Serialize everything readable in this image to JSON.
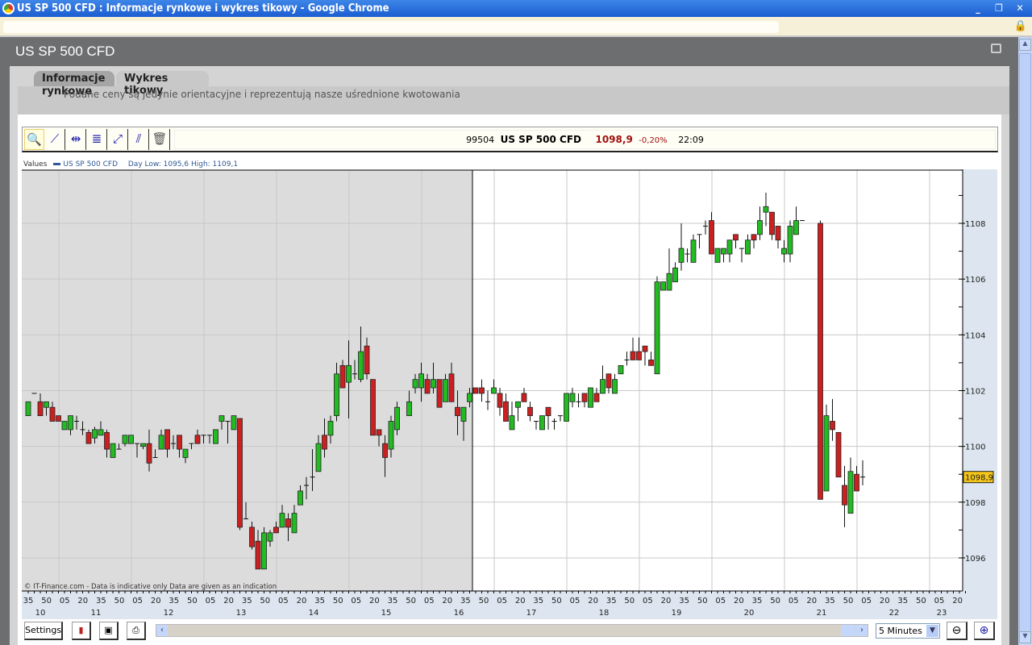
{
  "window": {
    "title": "US SP 500 CFD : Informacje rynkowe i wykres tikowy - Google Chrome",
    "buttons": [
      "_",
      "❐",
      "✕"
    ]
  },
  "page": {
    "title": "US SP 500 CFD"
  },
  "tabs": [
    {
      "label": "Informacje rynkowe"
    },
    {
      "label": "Wykres tikowy"
    }
  ],
  "disclaimer": "Podane ceny są jedynie orientacyjne i reprezentują nasze uśrednione kwotowania",
  "toolbar": {
    "tools": [
      {
        "icon": "zoom-icon",
        "glyph": "🔍"
      },
      {
        "icon": "trendline-icon",
        "glyph": "⟋"
      },
      {
        "icon": "horizontal-line-icon",
        "glyph": "⇹"
      },
      {
        "icon": "fibonacci-icon",
        "glyph": "≣"
      },
      {
        "icon": "channel-icon",
        "glyph": "⤢"
      },
      {
        "icon": "parallel-lines-icon",
        "glyph": "⫽"
      },
      {
        "icon": "trash-icon",
        "glyph": "🗑"
      }
    ]
  },
  "quote": {
    "code": "99504",
    "name": "US SP 500 CFD",
    "price": "1098,9",
    "change": "-0,20%",
    "time": "22:09"
  },
  "legend": {
    "label": "Values",
    "series": "US SP 500 CFD",
    "day_range": "Day Low: 1095,6 High: 1109,1"
  },
  "copyright": "© IT-Finance.com - Data is indicative only Data are given as an indication",
  "colors": {
    "up": "#22bb22",
    "down": "#cc2020",
    "shade": "#dcdcdc",
    "axis_bg": "#dde6f0",
    "price_tag": "#f5c518"
  },
  "chart_data": {
    "type": "candlestick",
    "interval": "5 Minutes",
    "ylim": [
      1095,
      1110
    ],
    "yticks": [
      1096,
      1098,
      1100,
      1102,
      1104,
      1106,
      1108
    ],
    "ytick_labels": [
      "1096",
      "1098",
      "1100",
      "1102",
      "1104",
      "1106",
      "1108"
    ],
    "last_price": 1098.9,
    "last_price_label": "1098,9",
    "xtick_labels": [
      "35",
      "50",
      "05",
      "20",
      "35",
      "50",
      "05",
      "20",
      "35",
      "50",
      "05",
      "20",
      "35",
      "50",
      "05",
      "20",
      "35",
      "50",
      "05",
      "20",
      "35",
      "50",
      "05",
      "20",
      "35",
      "50",
      "05",
      "20",
      "35",
      "50",
      "05",
      "20",
      "35",
      "50",
      "05",
      "20",
      "35",
      "50",
      "05",
      "20",
      "35",
      "50",
      "05",
      "20",
      "35",
      "50",
      "05",
      "20",
      "35",
      "50",
      "05",
      "20"
    ],
    "hour_labels": [
      "10",
      "11",
      "12",
      "13",
      "14",
      "15",
      "16",
      "17",
      "18",
      "19",
      "20",
      "21",
      "22",
      "23"
    ],
    "previous_session_candles": 74,
    "ohlc": [
      [
        1101.1,
        1101.6,
        1101.1,
        1101.6
      ],
      [
        1101.9,
        1101.9,
        1101.9,
        1101.9
      ],
      [
        1101.6,
        1101.9,
        1101.1,
        1101.1
      ],
      [
        1101.4,
        1101.6,
        1101.1,
        1101.6
      ],
      [
        1101.4,
        1101.6,
        1100.9,
        1100.9
      ],
      [
        1101.1,
        1101.1,
        1100.9,
        1100.9
      ],
      [
        1100.6,
        1100.9,
        1100.6,
        1100.9
      ],
      [
        1100.6,
        1101.1,
        1100.4,
        1101.1
      ],
      [
        1100.9,
        1101.1,
        1100.6,
        1100.9
      ],
      [
        1100.6,
        1100.9,
        1100.4,
        1100.6
      ],
      [
        1100.5,
        1100.6,
        1100.1,
        1100.1
      ],
      [
        1100.3,
        1100.7,
        1100.1,
        1100.6
      ],
      [
        1100.4,
        1100.9,
        1100.4,
        1100.6
      ],
      [
        1100.5,
        1100.6,
        1099.6,
        1099.9
      ],
      [
        1099.6,
        1100.1,
        1099.6,
        1100.1
      ],
      [
        1099.9,
        1100.1,
        1099.9,
        1099.9
      ],
      [
        1100.1,
        1100.4,
        1100.0,
        1100.4
      ],
      [
        1100.1,
        1100.4,
        1100.1,
        1100.4
      ],
      [
        1100.1,
        1100.1,
        1099.6,
        1100.1
      ],
      [
        1100.0,
        1100.1,
        1099.9,
        1100.1
      ],
      [
        1100.1,
        1100.6,
        1099.1,
        1099.4
      ],
      [
        1099.6,
        1099.9,
        1099.6,
        1099.6
      ],
      [
        1099.9,
        1100.6,
        1099.9,
        1100.4
      ],
      [
        1100.6,
        1100.6,
        1099.6,
        1099.9
      ],
      [
        1100.1,
        1100.4,
        1099.9,
        1100.1
      ],
      [
        1100.4,
        1100.4,
        1099.6,
        1099.9
      ],
      [
        1099.6,
        1099.9,
        1099.4,
        1099.9
      ],
      [
        1100.1,
        1100.1,
        1099.9,
        1100.1
      ],
      [
        1100.4,
        1100.6,
        1100.1,
        1100.1
      ],
      [
        1100.4,
        1100.4,
        1100.1,
        1100.4
      ],
      [
        1100.4,
        1100.4,
        1100.1,
        1100.4
      ],
      [
        1100.1,
        1100.6,
        1100.1,
        1100.6
      ],
      [
        1100.9,
        1101.1,
        1100.6,
        1101.1
      ],
      [
        1100.9,
        1100.9,
        1100.1,
        1100.9
      ],
      [
        1100.6,
        1101.1,
        1100.6,
        1101.1
      ],
      [
        1101.0,
        1101.0,
        1097.0,
        1097.1
      ],
      [
        1097.4,
        1098.0,
        1097.4,
        1097.4
      ],
      [
        1097.1,
        1097.3,
        1096.3,
        1096.4
      ],
      [
        1096.6,
        1097.0,
        1095.6,
        1095.6
      ],
      [
        1095.6,
        1097.1,
        1095.6,
        1096.9
      ],
      [
        1096.6,
        1097.0,
        1096.4,
        1096.9
      ],
      [
        1097.1,
        1097.3,
        1096.9,
        1096.9
      ],
      [
        1097.1,
        1097.9,
        1097.1,
        1097.6
      ],
      [
        1097.4,
        1097.6,
        1096.6,
        1097.1
      ],
      [
        1096.9,
        1097.9,
        1096.9,
        1097.6
      ],
      [
        1097.9,
        1098.6,
        1097.9,
        1098.4
      ],
      [
        1098.6,
        1098.9,
        1098.1,
        1098.6
      ],
      [
        1098.9,
        1099.9,
        1098.4,
        1098.9
      ],
      [
        1099.1,
        1100.4,
        1099.1,
        1100.1
      ],
      [
        1100.4,
        1101.0,
        1099.6,
        1099.9
      ],
      [
        1100.4,
        1101.1,
        1100.1,
        1100.9
      ],
      [
        1101.1,
        1103.0,
        1100.9,
        1102.6
      ],
      [
        1102.9,
        1103.1,
        1102.1,
        1102.1
      ],
      [
        1102.3,
        1103.8,
        1101.0,
        1102.9
      ],
      [
        1102.6,
        1103.1,
        1102.4,
        1102.6
      ],
      [
        1102.4,
        1104.3,
        1102.3,
        1103.4
      ],
      [
        1103.6,
        1103.9,
        1102.4,
        1102.6
      ],
      [
        1102.4,
        1102.4,
        1100.4,
        1100.4
      ],
      [
        1100.6,
        1100.6,
        1100.0,
        1100.4
      ],
      [
        1100.1,
        1100.4,
        1098.9,
        1099.6
      ],
      [
        1099.9,
        1101.1,
        1099.6,
        1100.9
      ],
      [
        1100.6,
        1101.6,
        1100.4,
        1101.4
      ],
      null,
      [
        1101.1,
        1102.0,
        1101.1,
        1101.6
      ],
      [
        1102.1,
        1102.6,
        1101.9,
        1102.4
      ],
      [
        1102.1,
        1103.0,
        1101.6,
        1102.6
      ],
      [
        1102.4,
        1102.6,
        1101.9,
        1101.9
      ],
      [
        1102.1,
        1103.0,
        1101.9,
        1102.4
      ],
      [
        1102.4,
        1102.4,
        1101.4,
        1101.4
      ],
      [
        1101.6,
        1102.6,
        1101.6,
        1102.4
      ],
      [
        1102.6,
        1103.0,
        1101.6,
        1101.6
      ],
      [
        1101.4,
        1102.0,
        1100.4,
        1101.1
      ],
      [
        1100.9,
        1101.4,
        1100.2,
        1101.4
      ],
      [
        1101.6,
        1102.1,
        1101.4,
        1101.9
      ],
      [
        1102.1,
        1102.1,
        1101.9,
        1101.9
      ],
      [
        1102.1,
        1102.4,
        1101.6,
        1101.9
      ],
      [
        1101.6,
        1102.0,
        1101.3,
        1101.6
      ],
      [
        1101.9,
        1102.4,
        1101.9,
        1102.1
      ],
      [
        1101.9,
        1102.1,
        1101.1,
        1101.4
      ],
      [
        1101.6,
        1101.9,
        1100.9,
        1100.9
      ],
      [
        1100.6,
        1101.6,
        1100.6,
        1101.1
      ],
      [
        1101.4,
        1101.6,
        1100.9,
        1101.6
      ],
      [
        1101.9,
        1102.1,
        1101.6,
        1101.6
      ],
      [
        1101.4,
        1101.6,
        1100.9,
        1101.1
      ],
      [
        1100.9,
        1100.9,
        1100.6,
        1100.9
      ],
      [
        1100.6,
        1101.1,
        1100.6,
        1101.1
      ],
      [
        1101.4,
        1101.4,
        1100.6,
        1101.1
      ],
      [
        1100.9,
        1101.0,
        1100.6,
        1100.9
      ],
      [
        1101.1,
        1101.1,
        1100.9,
        1101.1
      ],
      [
        1100.9,
        1101.9,
        1100.9,
        1101.9
      ],
      [
        1101.6,
        1102.1,
        1101.4,
        1101.9
      ],
      [
        1101.6,
        1101.9,
        1101.4,
        1101.6
      ],
      [
        1101.9,
        1101.9,
        1101.4,
        1101.6
      ],
      [
        1101.4,
        1102.1,
        1101.4,
        1102.1
      ],
      [
        1101.9,
        1102.1,
        1101.6,
        1101.6
      ],
      [
        1101.9,
        1102.9,
        1101.9,
        1102.4
      ],
      [
        1102.6,
        1102.6,
        1101.9,
        1102.1
      ],
      [
        1101.9,
        1102.6,
        1101.9,
        1102.4
      ],
      [
        1102.6,
        1102.9,
        1102.6,
        1102.9
      ],
      [
        1103.1,
        1103.4,
        1102.9,
        1103.1
      ],
      [
        1103.4,
        1103.9,
        1103.1,
        1103.1
      ],
      [
        1103.4,
        1103.9,
        1103.1,
        1103.1
      ],
      [
        1103.6,
        1103.6,
        1102.9,
        1103.4
      ],
      [
        1103.1,
        1103.4,
        1102.9,
        1102.9
      ],
      [
        1102.6,
        1106.1,
        1102.6,
        1105.9
      ],
      [
        1105.6,
        1105.9,
        1105.6,
        1105.9
      ],
      [
        1105.6,
        1107.1,
        1105.6,
        1106.2
      ],
      [
        1105.9,
        1106.6,
        1105.9,
        1106.4
      ],
      [
        1106.6,
        1108.0,
        1106.3,
        1107.1
      ],
      [
        1106.9,
        1107.1,
        1106.6,
        1106.9
      ],
      [
        1106.6,
        1107.6,
        1106.6,
        1107.4
      ],
      [
        1107.6,
        1107.6,
        1107.1,
        1107.6
      ],
      [
        1107.9,
        1108.1,
        1107.6,
        1107.9
      ],
      [
        1108.1,
        1108.4,
        1106.9,
        1106.9
      ],
      [
        1106.6,
        1107.1,
        1106.6,
        1107.1
      ],
      [
        1106.9,
        1107.1,
        1106.6,
        1107.1
      ],
      [
        1106.9,
        1107.4,
        1106.6,
        1107.4
      ],
      [
        1107.6,
        1107.6,
        1107.1,
        1107.4
      ],
      [
        1107.1,
        1107.1,
        1106.6,
        1107.1
      ],
      [
        1106.9,
        1107.6,
        1106.9,
        1107.4
      ],
      [
        1107.6,
        1107.6,
        1107.1,
        1107.4
      ],
      [
        1107.6,
        1108.6,
        1107.4,
        1108.1
      ],
      [
        1108.4,
        1109.1,
        1107.9,
        1108.6
      ],
      [
        1108.4,
        1108.4,
        1107.4,
        1107.6
      ],
      [
        1107.9,
        1107.9,
        1107.1,
        1107.4
      ],
      [
        1106.9,
        1107.4,
        1106.6,
        1107.1
      ],
      [
        1106.9,
        1108.1,
        1106.6,
        1107.9
      ],
      [
        1107.6,
        1108.6,
        1107.6,
        1108.1
      ],
      [
        1108.1,
        1108.1,
        1108.1,
        1108.1
      ],
      null,
      null,
      [
        1108.0,
        1108.1,
        1098.1,
        1098.1
      ],
      [
        1098.4,
        1101.5,
        1098.4,
        1101.1
      ],
      [
        1100.9,
        1101.7,
        1100.2,
        1100.6
      ],
      [
        1100.5,
        1100.5,
        1098.9,
        1098.9
      ],
      [
        1098.6,
        1099.3,
        1097.1,
        1097.9
      ],
      [
        1097.6,
        1099.6,
        1097.6,
        1099.1
      ],
      [
        1099.0,
        1099.3,
        1098.4,
        1098.4
      ],
      [
        1098.9,
        1099.5,
        1098.6,
        1098.9
      ]
    ]
  },
  "bottombar": {
    "settings": "Settings",
    "interval": "5 Minutes"
  }
}
